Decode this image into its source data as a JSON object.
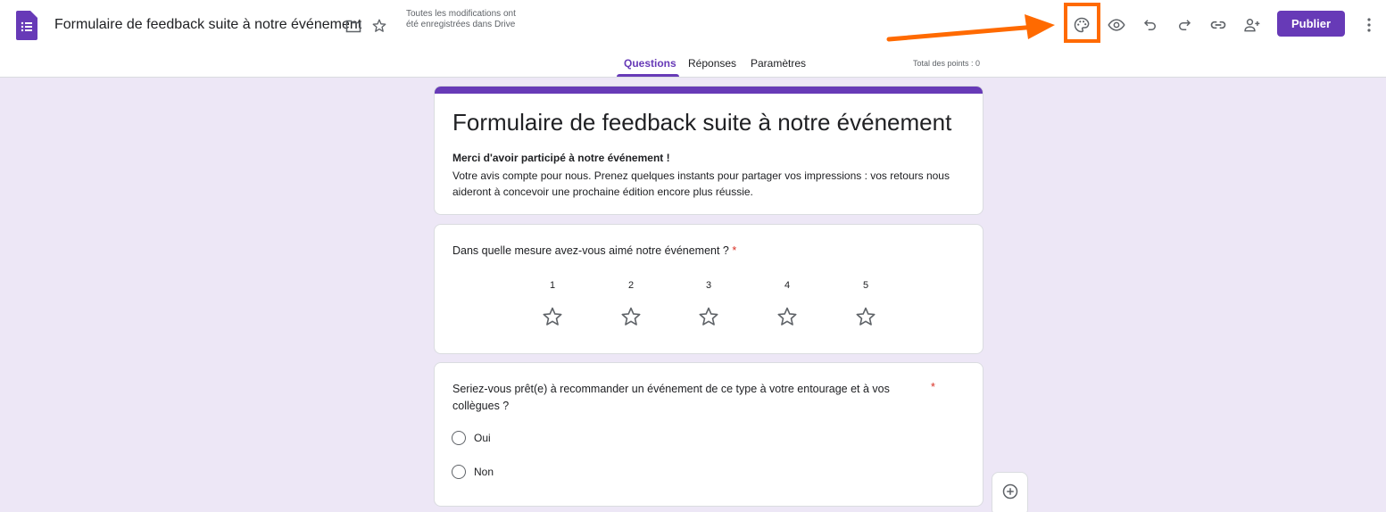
{
  "header": {
    "doc_title": "Formulaire de feedback suite à notre événement",
    "save_status": "Toutes les modifications ont été enregistrées dans Drive",
    "publish_label": "Publier",
    "accent_color": "#673ab7",
    "highlight_color": "#ff6a00",
    "toolbar_icons": [
      "palette-icon",
      "eye-icon",
      "undo-icon",
      "redo-icon",
      "link-icon",
      "add-person-icon",
      "more-vert-icon"
    ]
  },
  "tabs": [
    {
      "label": "Questions",
      "active": true
    },
    {
      "label": "Réponses",
      "active": false
    },
    {
      "label": "Paramètres",
      "active": false
    }
  ],
  "total_points": "Total des points : 0",
  "form": {
    "title": "Formulaire de feedback suite à notre événement",
    "description_bold": "Merci d'avoir participé à notre événement !",
    "description": "Votre avis compte pour nous. Prenez quelques instants pour partager vos impressions : vos retours nous aideront à concevoir une prochaine édition encore plus réussie."
  },
  "questions": [
    {
      "title": "Dans quelle mesure avez-vous aimé notre événement ?",
      "required_mark": "*",
      "type": "rating",
      "scale": [
        "1",
        "2",
        "3",
        "4",
        "5"
      ]
    },
    {
      "title": "Seriez-vous prêt(e) à recommander un événement de ce type à votre entourage et à vos collègues ?",
      "required_mark": "*",
      "type": "radio",
      "options": [
        "Oui",
        "Non"
      ]
    }
  ]
}
